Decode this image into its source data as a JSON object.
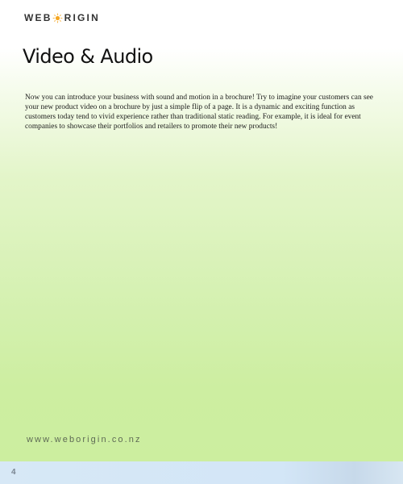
{
  "header": {
    "logo_left": "WEB",
    "logo_right": "RIGIN",
    "logo_icon": "sun-icon",
    "logo_icon_color": "#f5a623"
  },
  "main": {
    "title": "Video & Audio",
    "body": "Now you can introduce your business with sound and motion in a brochure! Try to imagine your customers can see your new product video on a brochure by just a simple flip of a page. It is a dynamic and exciting function as customers today tend to vivid experience rather than traditional static reading. For example, it is ideal for event companies to showcase their portfolios and retailers to promote their new products!"
  },
  "footer": {
    "url": "www.weborigin.co.nz",
    "page_number": "4"
  },
  "colors": {
    "background_top": "#ffffff",
    "background_bottom": "#ccee9f",
    "footer_bar": "#d3e6f7"
  }
}
